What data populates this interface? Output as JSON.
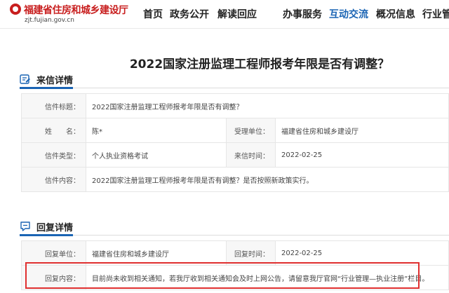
{
  "header": {
    "logo_text": "福建省住房和城乡建设厅",
    "logo_sub": "zjt.fujian.gov.cn",
    "nav": [
      {
        "label": "首页"
      },
      {
        "label": "政务公开"
      },
      {
        "label": "解读回应"
      },
      {
        "label": "办事服务"
      },
      {
        "label": "互动交流"
      },
      {
        "label": "概况信息"
      },
      {
        "label": "行业管理"
      }
    ],
    "active_nav": "互动交流",
    "active_color": "#1a64b4"
  },
  "page_title": "2022国家注册监理工程师报考年限是否有调整？",
  "letter": {
    "section_title": "来信详情",
    "icon": "mail-icon",
    "rows": {
      "title_label": "信件标题：",
      "title_value": "2022国家注册监理工程师报考年限是否有调整？",
      "name_label": "姓　　名：",
      "name_value": "陈*",
      "unit_label": "受理单位：",
      "unit_value": "福建省住房和城乡建设厅",
      "type_label": "信件类型：",
      "type_value": "个人执业资格考试",
      "time_label": "来信时间：",
      "time_value": "2022-02-25",
      "content_label": "信件内容：",
      "content_value": "2022国家注册监理工程师报考年限是否有调整？是否按照新政策实行。"
    }
  },
  "reply": {
    "section_title": "回复详情",
    "icon": "chat-icon",
    "rows": {
      "unit_label": "回复单位：",
      "unit_value": "福建省住房和城乡建设厅",
      "time_label": "回复时间：",
      "time_value": "2022-02-25",
      "content_label": "回复内容：",
      "content_value": "目前尚未收到相关通知，若我厅收到相关通知会及时上网公告，请留意我厅官网“行业管理—执业注册”栏目。"
    }
  },
  "highlight_color": "#e03030"
}
